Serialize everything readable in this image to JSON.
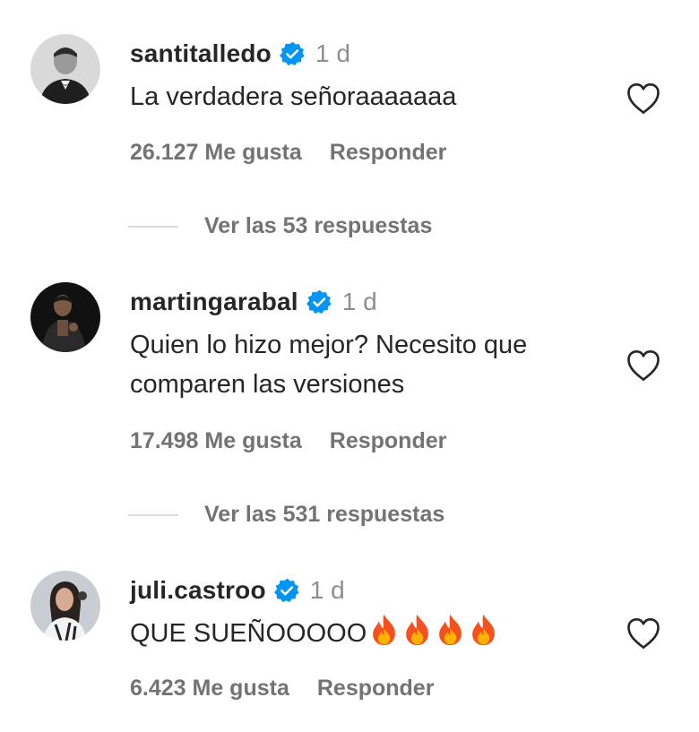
{
  "comments": [
    {
      "username": "santitalledo",
      "time": "1 d",
      "text": "La verdadera señoraaaaaaa",
      "likes": "26.127 Me gusta",
      "reply_label": "Responder",
      "view_replies": "Ver las 53 respuestas",
      "avatar_icon": "avatar-man-suit-icon"
    },
    {
      "username": "martingarabal",
      "time": "1 d",
      "text_lines": [
        "Quien lo hizo mejor? Necesito que",
        "comparen las versiones"
      ],
      "likes": "17.498 Me gusta",
      "reply_label": "Responder",
      "view_replies": "Ver las 531 respuestas",
      "avatar_icon": "avatar-man-dark-icon"
    },
    {
      "username": "juli.castroo",
      "time": "1 d",
      "text": "QUE SUEÑOOOOO",
      "emoji": "fire-emoji x4",
      "likes": "6.423 Me gusta",
      "reply_label": "Responder",
      "avatar_icon": "avatar-woman-icon"
    }
  ],
  "colors": {
    "text": "#262626",
    "secondary": "#737373",
    "time": "#8e8e8e",
    "verified": "#0095f6",
    "divider": "#dbdbdb"
  }
}
